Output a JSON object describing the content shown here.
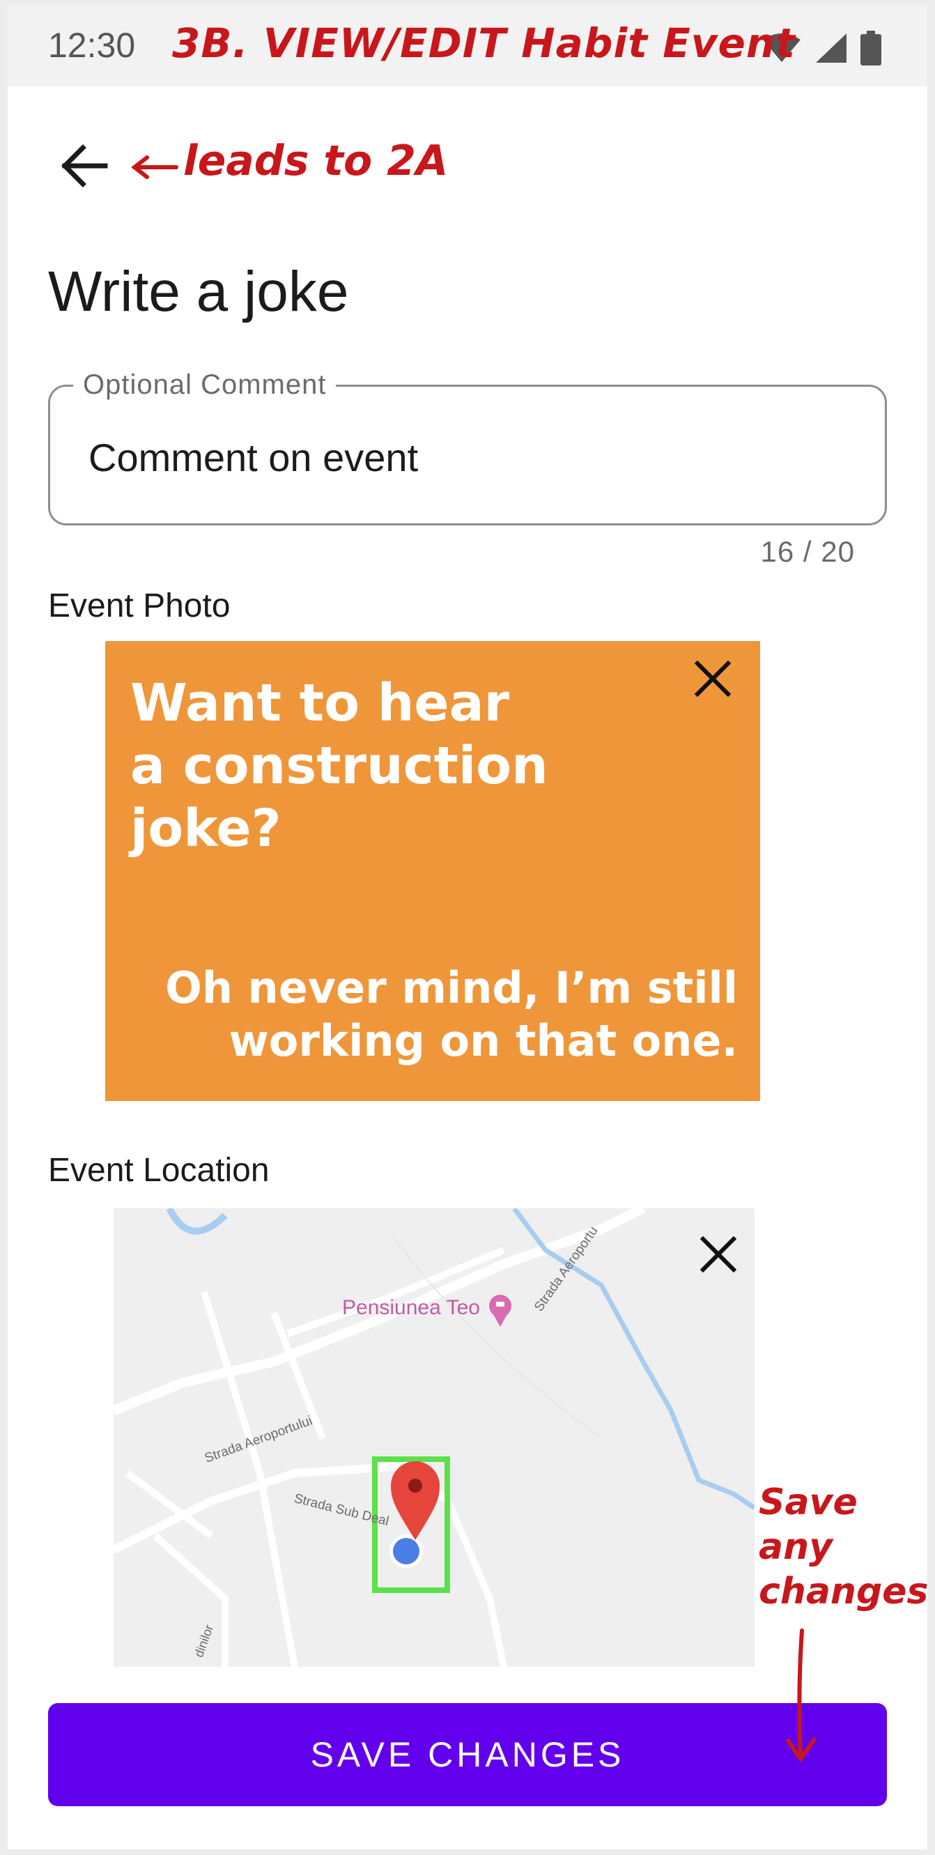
{
  "status_bar": {
    "time": "12:30",
    "icons": [
      "wifi-icon",
      "signal-icon",
      "battery-icon"
    ]
  },
  "annotations": {
    "screen_title": "3B. VIEW/EDIT Habit Event",
    "back_note": "leads to 2A",
    "save_note": "Save\nany\nchanges"
  },
  "header": {
    "back_icon": "arrow-left-icon",
    "title": "Write a joke"
  },
  "comment": {
    "label": "Optional Comment",
    "value": "Comment on event",
    "counter": "16 / 20"
  },
  "photo_section": {
    "label": "Event Photo",
    "joke_text": "Want to hear\na construction\njoke?",
    "punchline_text": "Oh never mind, I’m still\nworking on that one.",
    "close_icon": "close-icon"
  },
  "location_section": {
    "label": "Event Location",
    "close_icon": "close-icon",
    "map_labels": {
      "poi": "Pensiunea Teo",
      "street_1": "Strada Aeroportului",
      "street_2": "Strada Aeroportu",
      "street_3": "Strada Sub Deal",
      "street_4": "dinilor"
    }
  },
  "actions": {
    "save_label": "SAVE CHANGES"
  },
  "colors": {
    "accent": "#6200ee",
    "annotation": "#c8171b",
    "photo_background": "#ef963a",
    "pin_red": "#e5453b",
    "location_dot": "#4a7fe5",
    "highlight_green": "#5be14a"
  }
}
